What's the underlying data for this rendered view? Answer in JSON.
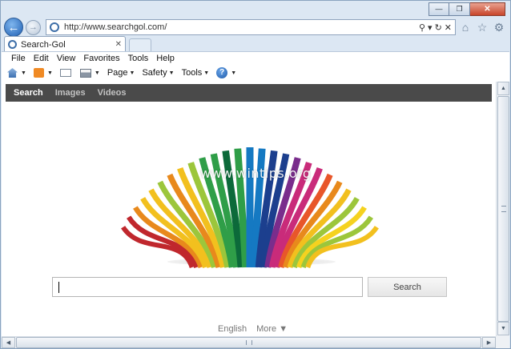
{
  "window": {
    "caption_buttons": [
      {
        "name": "minimize-button",
        "glyph": "—"
      },
      {
        "name": "maximize-button",
        "glyph": "❐"
      },
      {
        "name": "close-button",
        "glyph": "✕"
      }
    ]
  },
  "navigation": {
    "back_icon": "back-arrow-icon",
    "forward_icon": "forward-arrow-icon",
    "address_url": "http://www.searchgol.com/",
    "address_icons": [
      "search-icon",
      "refresh-icon",
      "close-icon"
    ],
    "right_icons": [
      {
        "name": "home-icon",
        "glyph": "⌂"
      },
      {
        "name": "favorites-star-icon",
        "glyph": "☆"
      },
      {
        "name": "tools-gear-icon",
        "glyph": "⚙"
      }
    ]
  },
  "tab": {
    "label": "Search-Gol",
    "close_glyph": "✕"
  },
  "menu": {
    "items": [
      "File",
      "Edit",
      "View",
      "Favorites",
      "Tools",
      "Help"
    ]
  },
  "commandbar": {
    "page_label": "Page",
    "safety_label": "Safety",
    "tools_label": "Tools"
  },
  "site": {
    "nav_items": [
      "Search",
      "Images",
      "Videos"
    ],
    "active_nav": "Search",
    "watermark": "www.wintips.org",
    "search_placeholder": "",
    "search_button": "Search",
    "footer_language": "English",
    "footer_more": "More ▼"
  },
  "colors": {
    "site_nav_bg": "#4a4a4a",
    "logo_palette": [
      "#c0272d",
      "#e8891c",
      "#f2c01e",
      "#9cc63b",
      "#2f9e48",
      "#0c6a3a",
      "#1579c2",
      "#1c3f8e",
      "#7a2d8c",
      "#c92b7a",
      "#e8562a",
      "#f5d21f"
    ]
  }
}
